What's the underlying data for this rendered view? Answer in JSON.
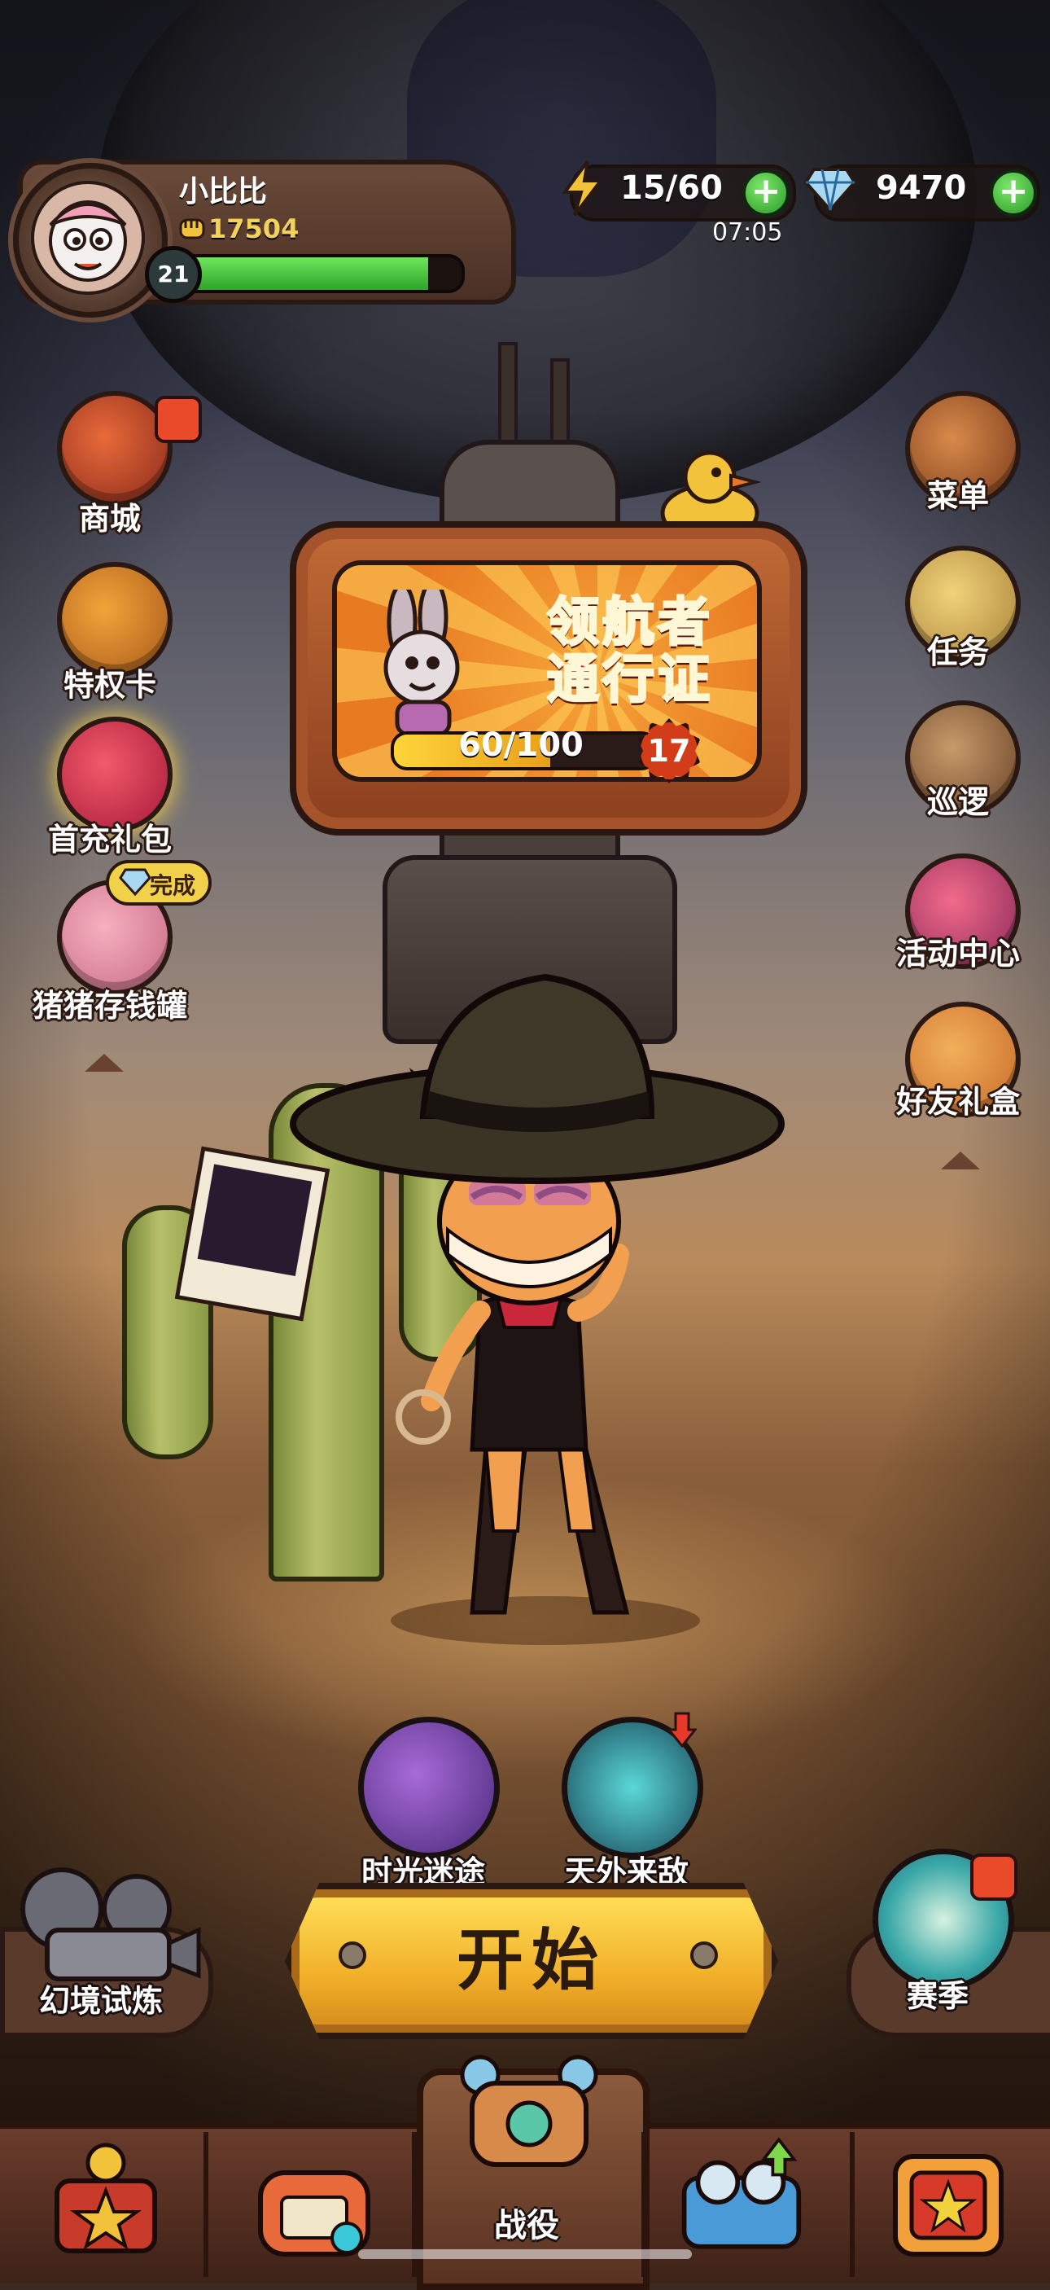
{
  "player": {
    "name": "小比比",
    "power": "17504",
    "level": "21",
    "xp_fraction": 0.88
  },
  "resources": {
    "energy": "15/60",
    "energy_timer": "07:05",
    "gems": "9470",
    "plus_symbol": "+"
  },
  "pass": {
    "title_line1": "领航者",
    "title_line2": "通行证",
    "progress_text": "60/100",
    "progress_fraction": 0.6,
    "level": "17"
  },
  "left_menu": {
    "shop": "商城",
    "privilege_card": "特权卡",
    "first_recharge_gift": "首充礼包",
    "piggy_bank": "猪猪存钱罐",
    "done_tag": "完成"
  },
  "right_menu": {
    "menu": "菜单",
    "tasks": "任务",
    "patrol": "巡逻",
    "activity_center": "活动中心",
    "friend_gift_box": "好友礼盒"
  },
  "modes": {
    "time_journey": "时光迷途",
    "alien_enemy": "天外来敌",
    "illusion_trial": "幻境试炼",
    "season": "赛季"
  },
  "start_button": "开始",
  "bottom_nav": {
    "battle": "战役"
  },
  "colors": {
    "xp_green": "#2ea42a",
    "start_yellow": "#f2b02a",
    "pass_red": "#e8142e"
  }
}
